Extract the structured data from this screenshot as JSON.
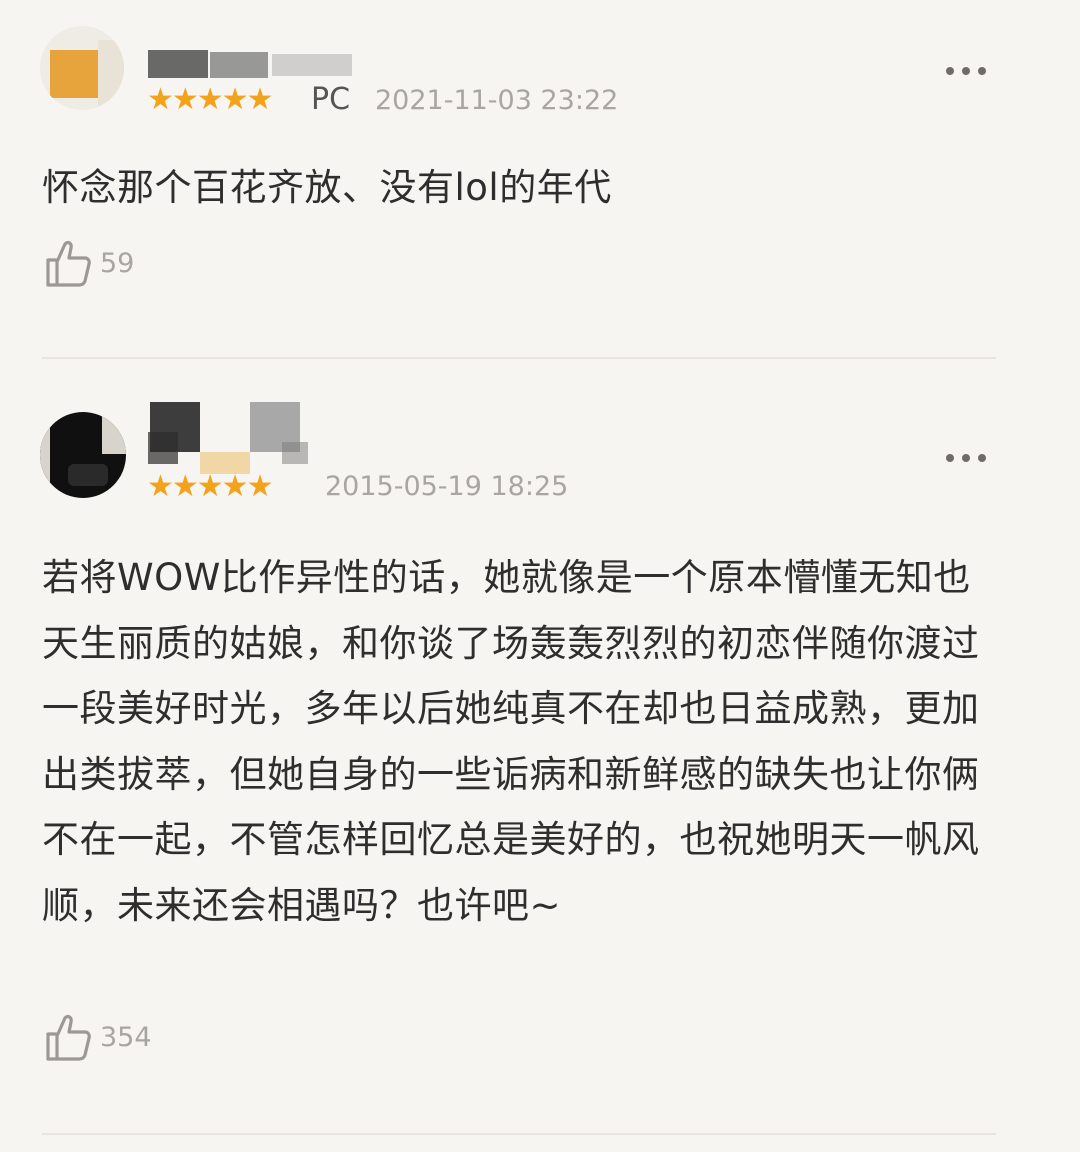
{
  "reviews": [
    {
      "rating_stars": "★★★★★",
      "platform": "PC",
      "time": "2021-11-03 23:22",
      "content": "怀念那个百花齐放、没有lol的年代",
      "likes": "59",
      "star_color": "#f3a21c"
    },
    {
      "rating_stars": "★★★★★",
      "platform": "",
      "time": "2015-05-19 18:25",
      "content": "若将WOW比作异性的话，她就像是一个原本懵懂无知也天生丽质的姑娘，和你谈了场轰轰烈烈的初恋伴随你渡过一段美好时光，多年以后她纯真不在却也日益成熟，更加出类拔萃，但她自身的一些诟病和新鲜感的缺失也让你俩不在一起，不管怎样回忆总是美好的，也祝她明天一帆风顺，未来还会相遇吗？也许吧~",
      "likes": "354",
      "star_color": "#f3a21c"
    }
  ]
}
